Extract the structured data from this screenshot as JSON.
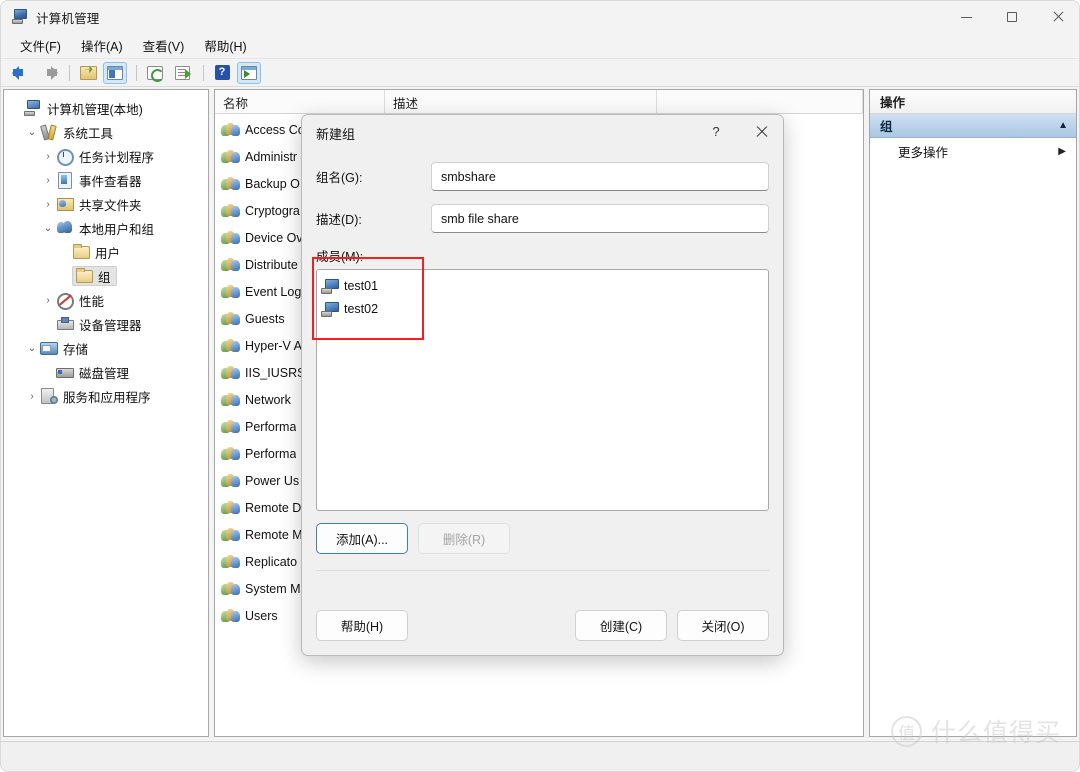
{
  "window": {
    "title": "计算机管理",
    "icon": "computer-management-icon",
    "controls": {
      "minimize": "−",
      "maximize": "□",
      "close": "✕"
    }
  },
  "menubar": {
    "items": [
      {
        "label": "文件(F)",
        "name": "menu-file"
      },
      {
        "label": "操作(A)",
        "name": "menu-action"
      },
      {
        "label": "查看(V)",
        "name": "menu-view"
      },
      {
        "label": "帮助(H)",
        "name": "menu-help"
      }
    ]
  },
  "toolbar": {
    "items": [
      {
        "name": "back-icon",
        "title": "后退"
      },
      {
        "name": "forward-icon",
        "title": "前进"
      },
      {
        "name": "up-folder-icon",
        "title": "向上"
      },
      {
        "name": "show-tree-pane-icon",
        "title": "显示/隐藏控制台树"
      },
      {
        "name": "refresh-icon",
        "title": "刷新"
      },
      {
        "name": "export-list-icon",
        "title": "导出列表"
      },
      {
        "name": "help-icon",
        "title": "帮助"
      },
      {
        "name": "show-action-pane-icon",
        "title": "显示/隐藏操作窗格"
      }
    ]
  },
  "tree": {
    "items": [
      {
        "label": "计算机管理(本地)",
        "icon": "i-computer",
        "indent": 0,
        "chevron": "",
        "selected": false
      },
      {
        "label": "系统工具",
        "icon": "i-tools",
        "indent": 1,
        "chevron": "⌄",
        "selected": false
      },
      {
        "label": "任务计划程序",
        "icon": "i-clock",
        "indent": 2,
        "chevron": "›",
        "selected": false
      },
      {
        "label": "事件查看器",
        "icon": "i-event",
        "indent": 2,
        "chevron": "›",
        "selected": false
      },
      {
        "label": "共享文件夹",
        "icon": "i-share",
        "indent": 2,
        "chevron": "›",
        "selected": false
      },
      {
        "label": "本地用户和组",
        "icon": "i-users",
        "indent": 2,
        "chevron": "⌄",
        "selected": false
      },
      {
        "label": "用户",
        "icon": "i-folder",
        "indent": 3,
        "chevron": "",
        "selected": false
      },
      {
        "label": "组",
        "icon": "i-folder",
        "indent": 3,
        "chevron": "",
        "selected": true
      },
      {
        "label": "性能",
        "icon": "i-perf",
        "indent": 2,
        "chevron": "›",
        "selected": false
      },
      {
        "label": "设备管理器",
        "icon": "i-device",
        "indent": 2,
        "chevron": "",
        "selected": false
      },
      {
        "label": "存储",
        "icon": "i-storage",
        "indent": 1,
        "chevron": "⌄",
        "selected": false
      },
      {
        "label": "磁盘管理",
        "icon": "i-disk",
        "indent": 2,
        "chevron": "",
        "selected": false
      },
      {
        "label": "服务和应用程序",
        "icon": "i-svc",
        "indent": 1,
        "chevron": "›",
        "selected": false
      }
    ]
  },
  "list": {
    "columns": [
      {
        "label": "名称",
        "name": "column-name"
      },
      {
        "label": "描述",
        "name": "column-description"
      }
    ],
    "rows": [
      {
        "name": "Access Co",
        "description": ""
      },
      {
        "name": "Administr",
        "description": ""
      },
      {
        "name": "Backup O",
        "description": ""
      },
      {
        "name": "Cryptogra",
        "description": ""
      },
      {
        "name": "Device Ov",
        "description": ""
      },
      {
        "name": "Distribute",
        "description": ""
      },
      {
        "name": "Event Log",
        "description": ""
      },
      {
        "name": "Guests",
        "description": ""
      },
      {
        "name": "Hyper-V A",
        "description": ""
      },
      {
        "name": "IIS_IUSRS",
        "description": ""
      },
      {
        "name": "Network ",
        "description": ""
      },
      {
        "name": "Performa",
        "description": ""
      },
      {
        "name": "Performa",
        "description": ""
      },
      {
        "name": "Power Us",
        "description": ""
      },
      {
        "name": "Remote D",
        "description": ""
      },
      {
        "name": "Remote M",
        "description": ""
      },
      {
        "name": "Replicato",
        "description": ""
      },
      {
        "name": "System M",
        "description": ""
      },
      {
        "name": "Users",
        "description": ""
      }
    ]
  },
  "actions": {
    "title": "操作",
    "section_label": "组",
    "section_caret": "▲",
    "items": [
      {
        "label": "更多操作",
        "caret": "▶"
      }
    ]
  },
  "dialog": {
    "title": "新建组",
    "help_glyph": "?",
    "close_glyph": "✕",
    "fields": [
      {
        "label": "组名(G):",
        "value": "smbshare",
        "name": "group-name-input"
      },
      {
        "label": "描述(D):",
        "value": "smb file share",
        "name": "description-input"
      }
    ],
    "members_label": "成员(M):",
    "members": [
      {
        "name": "test01"
      },
      {
        "name": "test02"
      }
    ],
    "member_buttons": [
      {
        "label": "添加(A)...",
        "state": "primary",
        "name": "add-member-button"
      },
      {
        "label": "删除(R)",
        "state": "disabled",
        "name": "remove-member-button"
      }
    ],
    "footer_buttons": [
      {
        "label": "帮助(H)",
        "align": "left",
        "name": "help-button"
      },
      {
        "label": "创建(C)",
        "align": "right",
        "name": "create-button"
      },
      {
        "label": "关闭(O)",
        "align": "right",
        "name": "close-button"
      }
    ]
  },
  "annotation": {
    "color": "#f61f1f"
  },
  "watermark": {
    "logo": "值",
    "text": "什么值得买"
  }
}
